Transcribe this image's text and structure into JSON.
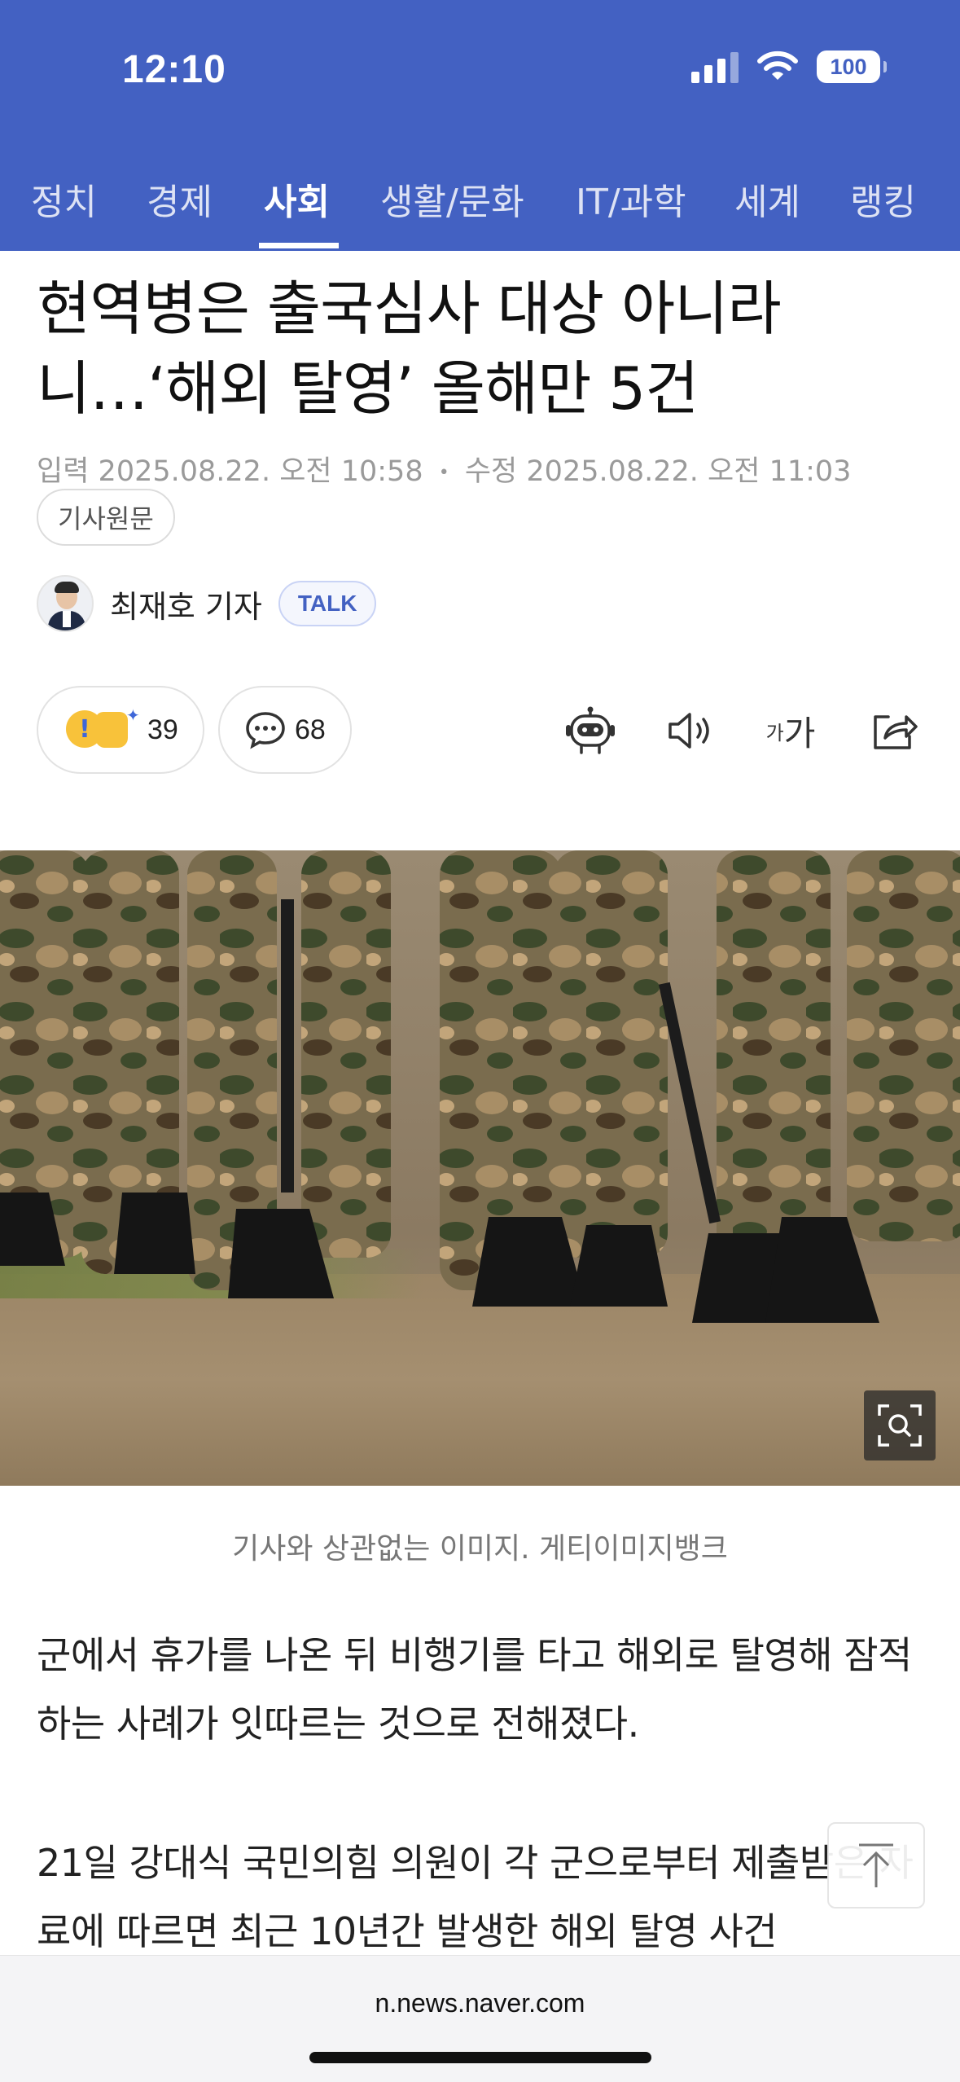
{
  "status_bar": {
    "time": "12:10",
    "battery": "100"
  },
  "tabs": [
    {
      "label": "정치"
    },
    {
      "label": "경제"
    },
    {
      "label": "사회",
      "active": true
    },
    {
      "label": "생활/문화"
    },
    {
      "label": "IT/과학"
    },
    {
      "label": "세계"
    },
    {
      "label": "랭킹"
    }
  ],
  "article": {
    "headline": "현역병은 출국심사 대상 아니라니…‘해외 탈영’ 올해만 5건",
    "published_label": "입력",
    "published": "2025.08.22. 오전 10:58",
    "modified_label": "수정",
    "modified": "2025.08.22. 오전 11:03",
    "original_link": "기사원문",
    "reporter": "최재호 기자",
    "talk_label": "TALK",
    "reaction_count": "39",
    "comment_count": "68",
    "font_size_label_small": "가",
    "font_size_label_large": "가",
    "photo_caption": "기사와 상관없는 이미지. 게티이미지뱅크",
    "paragraphs": [
      "군에서 휴가를 나온 뒤 비행기를 타고 해외로 탈영해 잠적하는 사례가 잇따르는 것으로 전해졌다.",
      "21일 강대식 국민의힘 의원이 각 군으로부터 제출받은 자료에 따르면 최근 10년간 발생한 해외 탈영 사건"
    ]
  },
  "icons": {
    "reaction": "reaction-emoji-icon",
    "comment": "comment-bubble-icon",
    "robot": "robot-summary-icon",
    "speaker": "speaker-icon",
    "font": "font-size-icon",
    "share": "share-icon",
    "zoom": "image-zoom-icon",
    "scroll_top": "arrow-up-icon"
  },
  "browser": {
    "url": "n.news.naver.com"
  },
  "colors": {
    "header": "#4361c2",
    "accent": "#4361c2",
    "text": "#111111",
    "muted": "#9a9a9a"
  }
}
